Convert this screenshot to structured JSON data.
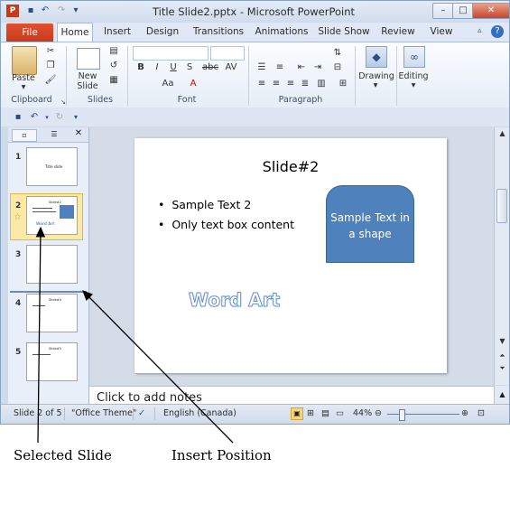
{
  "window": {
    "title": "Title Slide2.pptx - Microsoft PowerPoint",
    "controls": [
      "–",
      "□",
      "✕"
    ]
  },
  "quick_access": [
    "save-icon",
    "undo-icon",
    "redo-icon",
    "customize-icon"
  ],
  "tabs": [
    {
      "label": "File"
    },
    {
      "label": "Home"
    },
    {
      "label": "Insert"
    },
    {
      "label": "Design"
    },
    {
      "label": "Transitions"
    },
    {
      "label": "Animations"
    },
    {
      "label": "Slide Show"
    },
    {
      "label": "Review"
    },
    {
      "label": "View"
    }
  ],
  "ribbon": {
    "clipboard": {
      "paste": "Paste",
      "group": "Clipboard"
    },
    "slides": {
      "new_slide": "New Slide",
      "group": "Slides"
    },
    "font": {
      "group": "Font",
      "buttons": [
        "B",
        "I",
        "U",
        "S",
        "abc",
        "AV",
        "Aa",
        "A"
      ]
    },
    "paragraph": {
      "group": "Paragraph"
    },
    "drawing": {
      "label": "Drawing"
    },
    "editing": {
      "label": "Editing"
    }
  },
  "slides_panel": {
    "thumbnails": [
      {
        "num": "1",
        "title": "Title slide"
      },
      {
        "num": "2",
        "title": "Slide#2",
        "selected": true,
        "word_art": "Word Art"
      },
      {
        "num": "3",
        "title": ""
      },
      {
        "num": "4",
        "title": "Slide#4"
      },
      {
        "num": "5",
        "title": "Slide#5"
      }
    ]
  },
  "slide": {
    "title": "Slide#2",
    "bullets": [
      "Sample Text 2",
      "Only text box content"
    ],
    "shape_text": "Sample Text in a shape",
    "word_art": "Word Art"
  },
  "notes": {
    "placeholder": "Click to add notes"
  },
  "status": {
    "slide_info": "Slide 2 of 5",
    "theme": "\"Office Theme\"",
    "language": "English (Canada)",
    "zoom": "44%"
  },
  "annotations": {
    "selected_slide": "Selected Slide",
    "insert_position": "Insert Position"
  },
  "colors": {
    "file_tab": "#c43b1c",
    "shape_fill": "#4f81bd",
    "selection": "#fbe9a8"
  }
}
